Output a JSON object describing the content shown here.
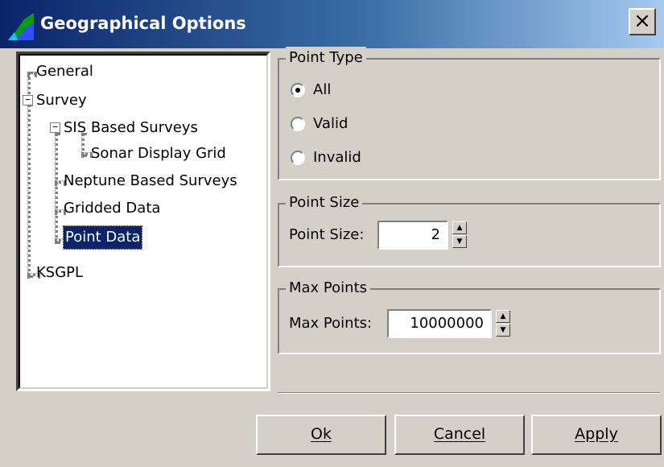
{
  "window": {
    "title": "Geographical Options",
    "close_glyph": "×"
  },
  "tree": {
    "general": "General",
    "survey": "Survey",
    "sis_based_surveys": "SIS Based Surveys",
    "sonar_display_grid": "Sonar Display Grid",
    "neptune_based_surveys": "Neptune Based Surveys",
    "gridded_data": "Gridded Data",
    "point_data": "Point Data",
    "ksgpl": "KSGPL",
    "selected": "Point Data",
    "expander_collapsed": "−"
  },
  "point_type": {
    "legend": "Point Type",
    "options": [
      "All",
      "Valid",
      "Invalid"
    ],
    "selected": "All"
  },
  "point_size": {
    "legend": "Point Size",
    "label": "Point Size:",
    "value": "2"
  },
  "max_points": {
    "legend": "Max Points",
    "label": "Max Points:",
    "value": "10000000"
  },
  "buttons": {
    "ok": "Ok",
    "cancel": "Cancel",
    "apply": "Apply"
  },
  "colors": {
    "selection": "#0a246a",
    "dialog_bg": "#d4d0c8",
    "title_start": "#0a246a",
    "title_end": "#a6caf0"
  }
}
